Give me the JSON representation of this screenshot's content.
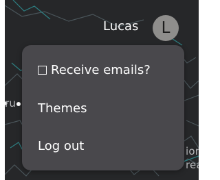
{
  "header": {
    "user_name": "Lucas",
    "avatar_initial": "L"
  },
  "menu": {
    "items": [
      {
        "label": "Receive emails?",
        "icon": "checkbox-unchecked-icon"
      },
      {
        "label": "Themes"
      },
      {
        "label": "Log out"
      }
    ]
  },
  "map": {
    "visible_labels": [
      "ru",
      "ion",
      "rea"
    ]
  },
  "colors": {
    "map_background": "#262729",
    "menu_background": "#49484c",
    "avatar_background": "#8f8e8c",
    "text": "#ffffff",
    "road_lines": "#4f5b60",
    "water_lines": "#2f8f92",
    "map_label": "#b7b8bb"
  }
}
